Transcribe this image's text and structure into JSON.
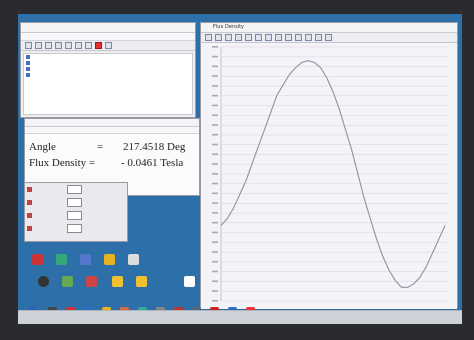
{
  "readout": {
    "angle_label": "Angle",
    "angle_eq": "=",
    "angle_value": "217.4518 Deg",
    "flux_label": "Flux Density =",
    "flux_value": "- 0.0461 Tesla"
  },
  "plot_window": {
    "title": "Flux Density"
  },
  "chart_data": {
    "type": "line",
    "title": "",
    "xlabel": "",
    "ylabel": "",
    "grid": true,
    "x": [
      0,
      10,
      20,
      30,
      40,
      50,
      60,
      70,
      80,
      90,
      100,
      110,
      120,
      130,
      140,
      150,
      160,
      170,
      180,
      190,
      200,
      210,
      220,
      230,
      240,
      250,
      260,
      270,
      280,
      290,
      300,
      310,
      320,
      330,
      340,
      350,
      360
    ],
    "series": [
      {
        "values": [
          -0.1,
          -0.08,
          -0.05,
          -0.01,
          0.03,
          0.08,
          0.13,
          0.18,
          0.23,
          0.28,
          0.31,
          0.34,
          0.36,
          0.375,
          0.38,
          0.375,
          0.36,
          0.33,
          0.29,
          0.24,
          0.18,
          0.12,
          0.05,
          -0.02,
          -0.08,
          -0.14,
          -0.19,
          -0.23,
          -0.26,
          -0.28,
          -0.28,
          -0.27,
          -0.25,
          -0.22,
          -0.18,
          -0.14,
          -0.1
        ]
      }
    ],
    "xlim": [
      0,
      360
    ],
    "ylim": [
      -0.32,
      0.42
    ],
    "line_color": "#8f8fa6"
  },
  "colors": {
    "desktop": "#2d6fa8",
    "plot_bg": "#f4f3f7",
    "grid": "#d9d8e0"
  }
}
